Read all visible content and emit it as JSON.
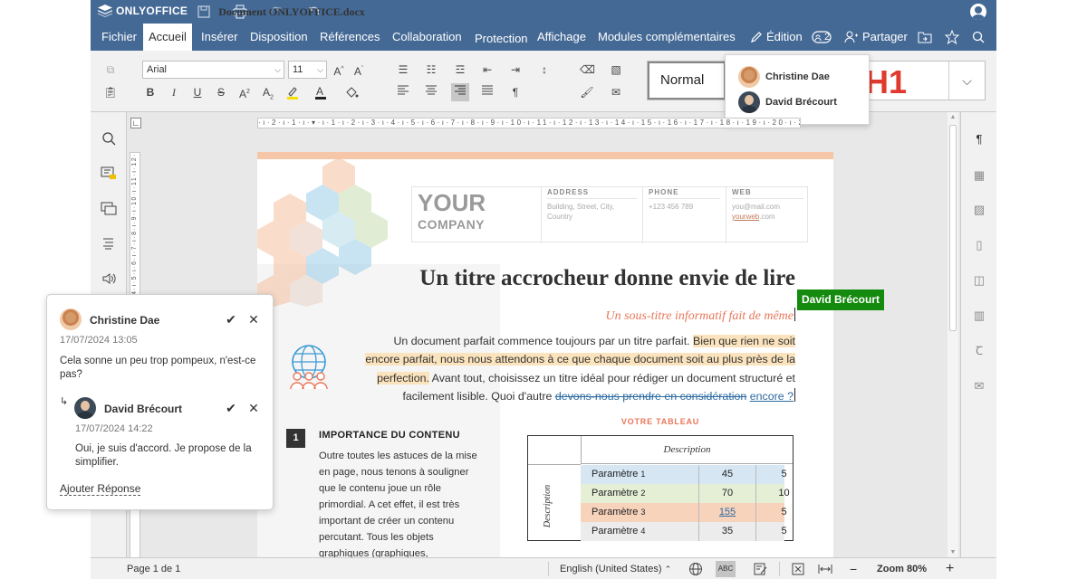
{
  "window": {
    "brand": "ONLYOFFICE",
    "document_title": "Document ONLYOFFICE.docx"
  },
  "menu": {
    "tabs": [
      "Fichier",
      "Accueil",
      "Insérer",
      "Disposition",
      "Références",
      "Collaboration",
      "Protection",
      "Affichage",
      "Modules complémentaires"
    ],
    "active_tab": "Accueil",
    "edit_label": "Édition",
    "coauthors_count": "2",
    "share_label": "Partager"
  },
  "toolbar": {
    "font_name": "Arial",
    "font_size": "11",
    "style_normal": "Normal",
    "style_h1": "H1"
  },
  "coauthors_popup": {
    "users": [
      "Christine Dae",
      "David Brécourt"
    ]
  },
  "document": {
    "company_your": "YOUR",
    "company_name": "COMPANY",
    "address_label": "ADDRESS",
    "address_value": "Building, Street, City, Country",
    "phone_label": "PHONE",
    "phone_value": "+123 456 789",
    "web_label": "WEB",
    "web_value_1": "you@mail.com",
    "web_value_2a": "yourweb",
    "web_value_2b": ".com",
    "title": "Un titre accrocheur donne envie de lire",
    "subtitle": "Un sous-titre informatif fait de même",
    "para_1": "Un document parfait commence toujours par un titre parfait. ",
    "para_hl": "Bien que rien ne soit encore parfait, nous nous attendons à ce que chaque document soit au plus près de la perfection.",
    "para_2": " Avant tout, choisissez un titre idéal pour rédiger un document structuré et facilement lisible. Quoi d'autre ",
    "para_del": "devons-nous prendre en considération",
    "para_ins": "encore ?",
    "section_number": "1",
    "section_title": "IMPORTANCE DU CONTENU",
    "section_text": "Outre toutes les astuces de la mise en page, nous tenons à souligner que le contenu joue un rôle primordial. A cet effet, il est très important de créer un contenu percutant. Tous les objets graphiques (graphiques,",
    "table_caption": "VOTRE TABLEAU",
    "table_header": "Description",
    "table_side": "Description",
    "table_rows": [
      {
        "label": "Paramètre",
        "num": "1",
        "a": "45",
        "b": "5",
        "color": "#d6e7f3"
      },
      {
        "label": "Paramètre",
        "num": "2",
        "a": "70",
        "b": "10",
        "color": "#e5efd6"
      },
      {
        "label": "Paramètre",
        "num": "3",
        "a": "155",
        "b": "5",
        "color": "#f8d3bc"
      },
      {
        "label": "Paramètre",
        "num": "4",
        "a": "35",
        "b": "5",
        "color": "#ececec"
      }
    ]
  },
  "cursor_tag": "David Brécourt",
  "comment": {
    "author": "Christine Dae",
    "date": "17/07/2024 13:05",
    "text": "Cela sonne un peu trop pompeux, n'est-ce pas?",
    "reply_author": "David Brécourt",
    "reply_date": "17/07/2024 14:22",
    "reply_text": "Oui, je suis d'accord. Je propose de la simplifier.",
    "add_reply": "Ajouter Réponse"
  },
  "status": {
    "page": "Page 1 de 1",
    "language": "English (United States)",
    "zoom": "Zoom 80%"
  },
  "colors": {
    "header_blue": "#446995",
    "accent_orange": "#e9775a",
    "highlight": "#fbe3bd",
    "cursor_tag_green": "#148a0f"
  }
}
